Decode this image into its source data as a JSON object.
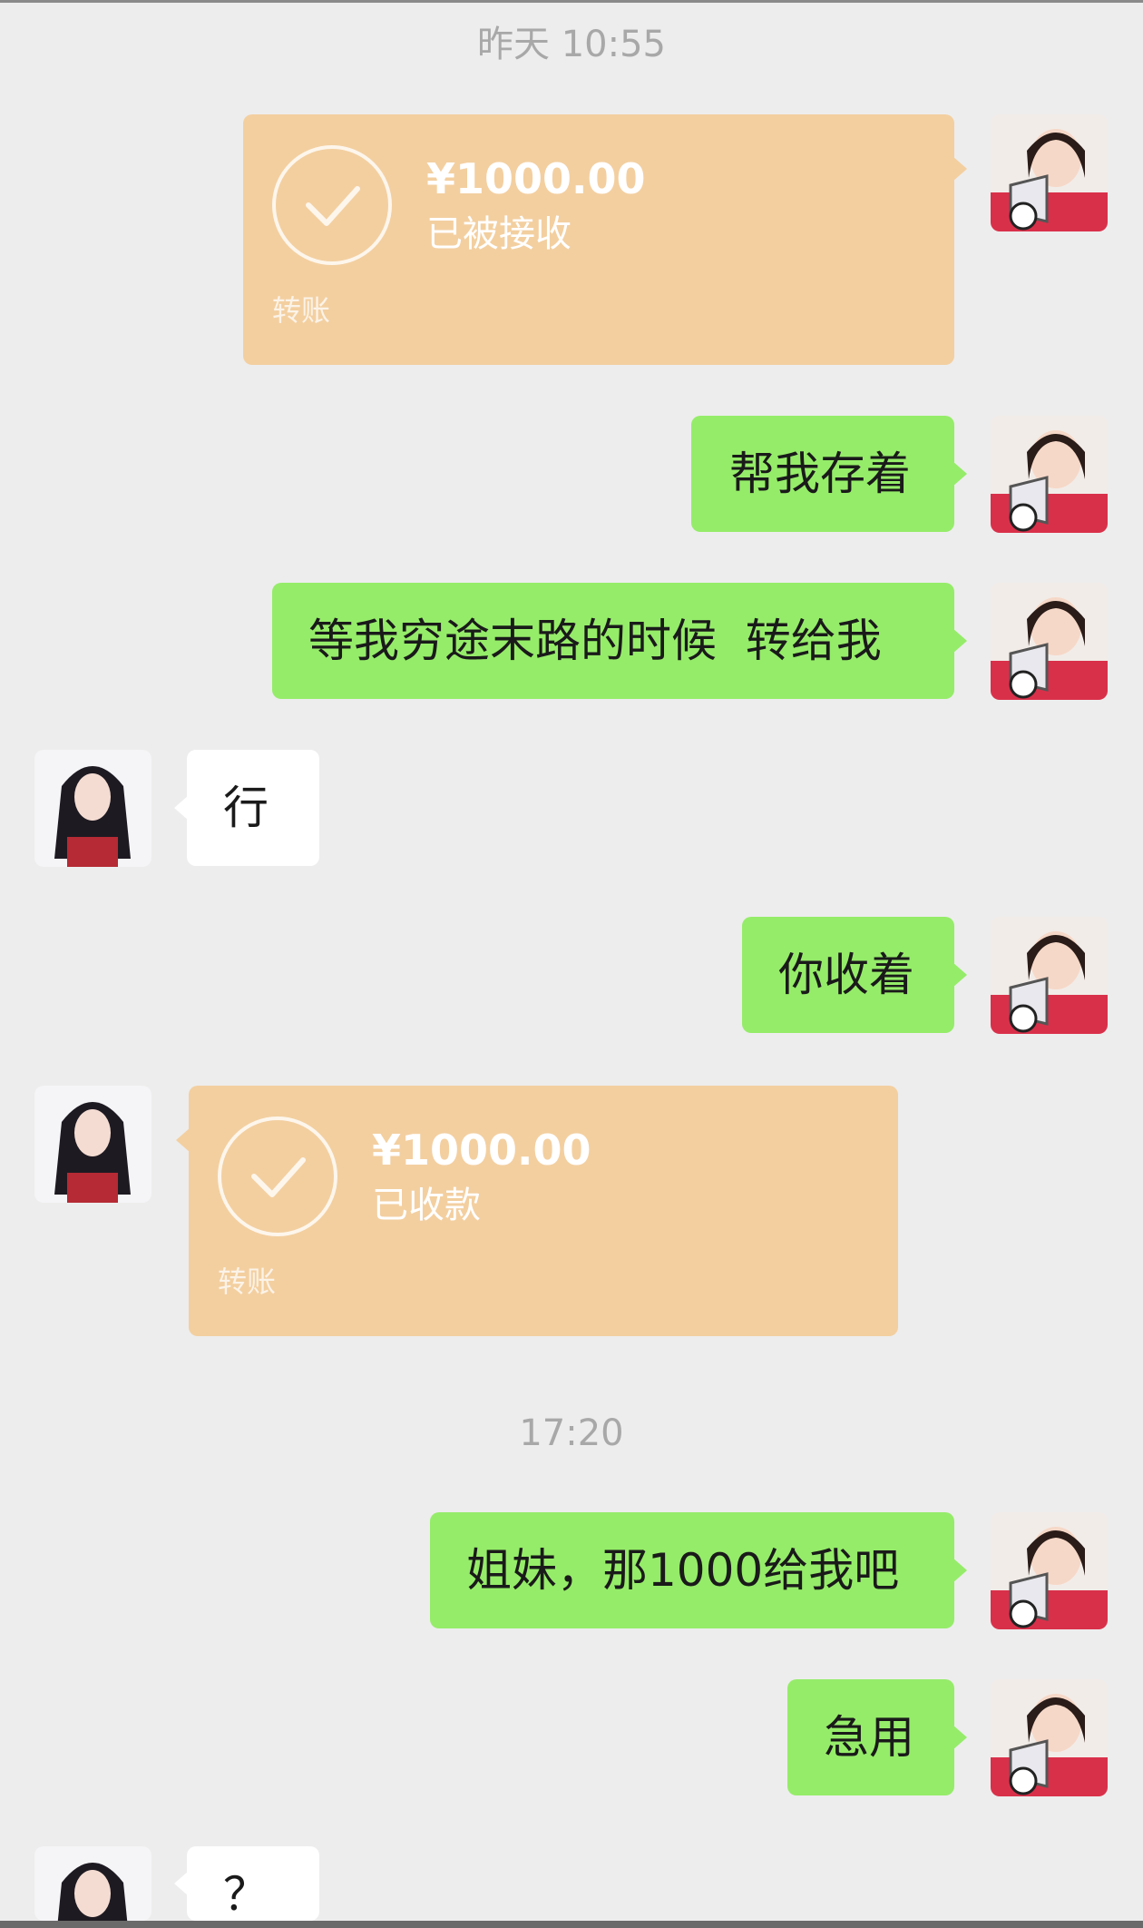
{
  "timestamps": [
    "昨天 10:55",
    "17:20"
  ],
  "messages": [
    {
      "side": "right",
      "type": "transfer",
      "amount": "¥1000.00",
      "status": "已被接收",
      "label": "转账"
    },
    {
      "side": "right",
      "type": "text",
      "text": "帮我存着"
    },
    {
      "side": "right",
      "type": "text",
      "text": "等我穷途末路的时候  转给我"
    },
    {
      "side": "left",
      "type": "text",
      "text": "行"
    },
    {
      "side": "right",
      "type": "text",
      "text": "你收着"
    },
    {
      "side": "left",
      "type": "transfer",
      "amount": "¥1000.00",
      "status": "已收款",
      "label": "转账"
    },
    {
      "side": "right",
      "type": "text",
      "text": "姐妹，那1000给我吧"
    },
    {
      "side": "right",
      "type": "text",
      "text": "急用"
    },
    {
      "side": "left",
      "type": "text",
      "text": "？"
    }
  ],
  "colors": {
    "sent_bubble": "#95ec69",
    "received_bubble": "#ffffff",
    "transfer_bubble": "#f3cfa0",
    "background": "#ededed"
  },
  "icons": {
    "transfer_done": "check-circle-icon",
    "self_avatar": "megaphone-girl-avatar",
    "contact_avatar": "long-hair-girl-avatar"
  }
}
